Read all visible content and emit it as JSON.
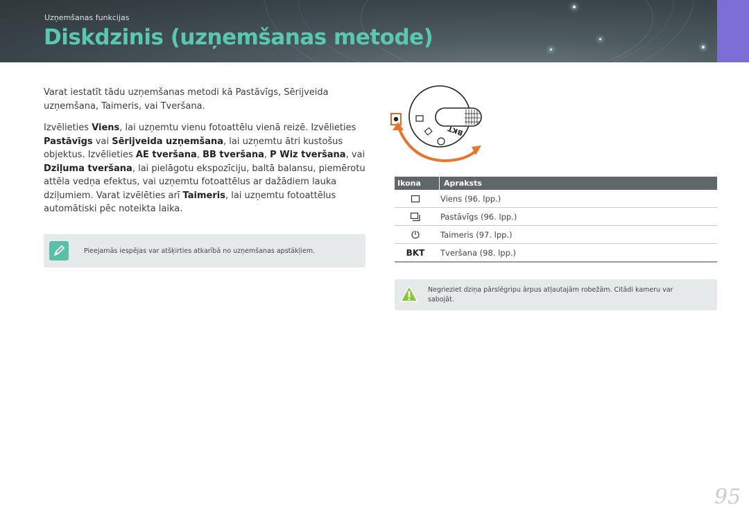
{
  "header": {
    "breadcrumb": "Uzņemšanas funkcijas",
    "title": "Diskdzinis (uzņemšanas metode)",
    "accent_color": "#58c8b3",
    "tab_color": "#7b6fd6"
  },
  "intro": {
    "p1": "Varat iestatīt tādu uzņemšanas metodi kā Pastāvīgs, Sērijveida uzņemšana, Taimeris, vai Tveršana.",
    "p2": {
      "t1": "Izvēlieties ",
      "b1": "Viens",
      "t2": ", lai uzņemtu vienu fotoattēlu vienā reizē. Izvēlieties ",
      "b2": "Pastāvīgs",
      "t3": " vai ",
      "b3": "Sērijveida uzņemšana",
      "t4": ", lai uzņemtu ātri kustošus objektus. Izvēlieties ",
      "b4": "AE tveršana",
      "t5": ", ",
      "b5": "BB tveršana",
      "t6": ", ",
      "b6": "P Wiz tveršana",
      "t7": ", vai ",
      "b7": "Dziļuma tveršana",
      "t8": ", lai pielāgotu ekspozīciju, baltā balansu, piemērotu attēla vedņa efektus, vai uzņemtu fotoattēlus ar dažādiem lauka dziļumiem. Varat izvēlēties arī ",
      "b8": "Taimeris",
      "t9": ", lai uzņemtu fotoattēlus automātiski pēc noteikta laika."
    }
  },
  "note": {
    "icon": "pencil-note-icon",
    "text": "Pieejamās iespējas var atšķirties atkarībā no uzņemšanas apstākļiem."
  },
  "dial": {
    "dial_label": "BKT"
  },
  "table": {
    "col_icon": "Ikona",
    "col_desc": "Apraksts",
    "rows": [
      {
        "icon": "single-frame-icon",
        "desc": "Viens (96. lpp.)"
      },
      {
        "icon": "continuous-icon",
        "desc": "Pastāvīgs (96. lpp.)"
      },
      {
        "icon": "timer-icon",
        "desc": "Taimeris (97. lpp.)"
      },
      {
        "icon": "bkt-icon",
        "icon_text": "BKT",
        "desc": "Tveršana (98. lpp.)"
      }
    ]
  },
  "warning": {
    "icon": "warning-icon",
    "text": "Negrieziet dziņa pārslēgripu ārpus atļautajām robežām. Citādi kameru var sabojāt."
  },
  "page_number": "95"
}
